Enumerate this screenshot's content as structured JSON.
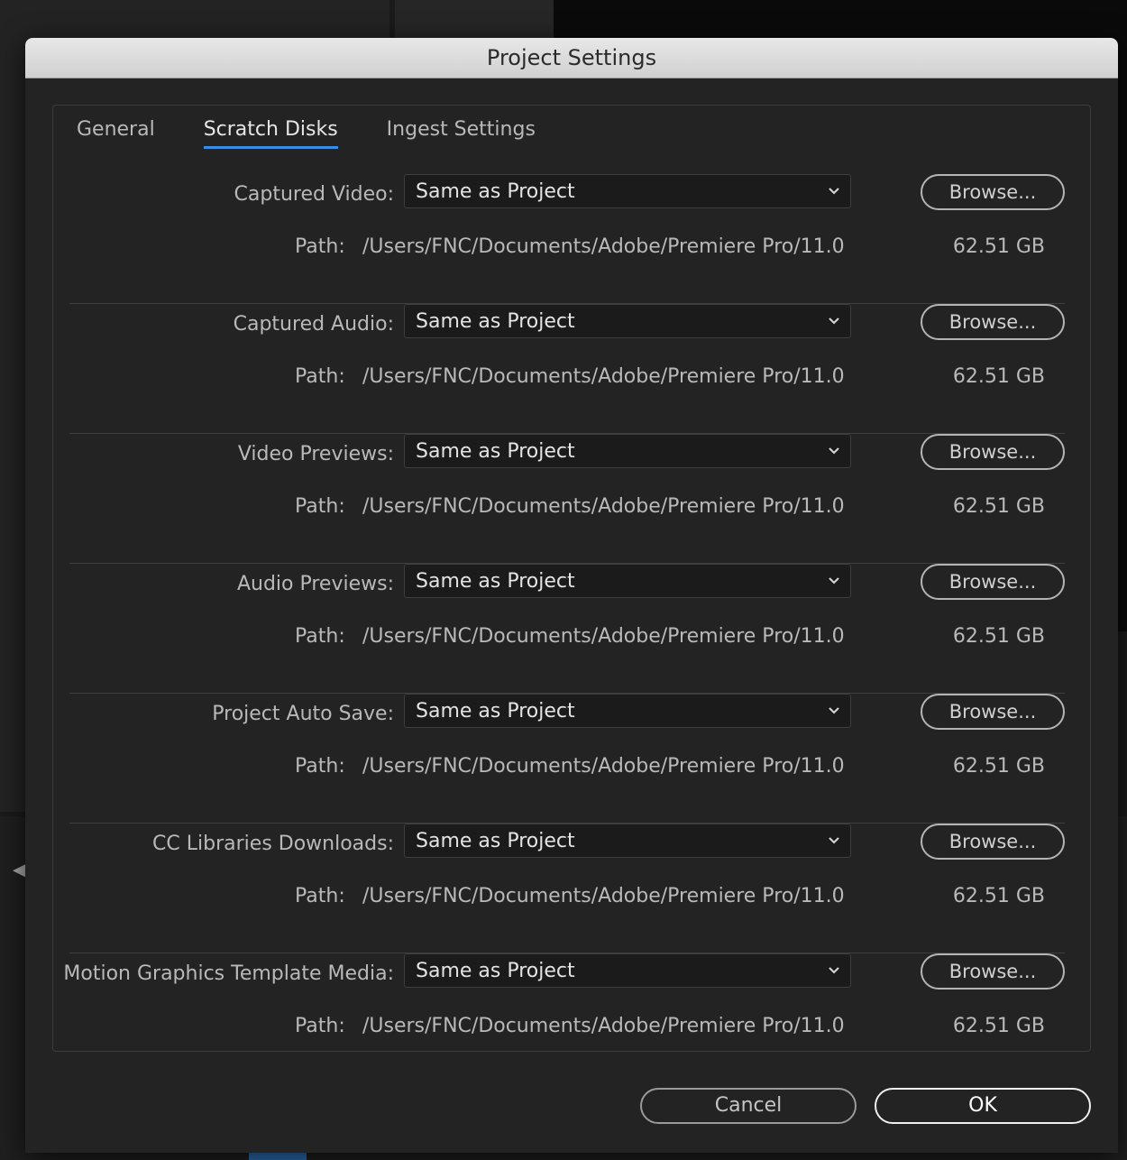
{
  "dialog": {
    "title": "Project Settings"
  },
  "tabs": [
    {
      "label": "General",
      "active": false
    },
    {
      "label": "Scratch Disks",
      "active": true
    },
    {
      "label": "Ingest Settings",
      "active": false
    }
  ],
  "path_label": "Path:",
  "rows": [
    {
      "label": "Captured Video:",
      "value": "Same as Project",
      "path": "/Users/FNC/Documents/Adobe/Premiere Pro/11.0",
      "size": "62.51 GB",
      "browse": "Browse..."
    },
    {
      "label": "Captured Audio:",
      "value": "Same as Project",
      "path": "/Users/FNC/Documents/Adobe/Premiere Pro/11.0",
      "size": "62.51 GB",
      "browse": "Browse..."
    },
    {
      "label": "Video Previews:",
      "value": "Same as Project",
      "path": "/Users/FNC/Documents/Adobe/Premiere Pro/11.0",
      "size": "62.51 GB",
      "browse": "Browse..."
    },
    {
      "label": "Audio Previews:",
      "value": "Same as Project",
      "path": "/Users/FNC/Documents/Adobe/Premiere Pro/11.0",
      "size": "62.51 GB",
      "browse": "Browse..."
    },
    {
      "label": "Project Auto Save:",
      "value": "Same as Project",
      "path": "/Users/FNC/Documents/Adobe/Premiere Pro/11.0",
      "size": "62.51 GB",
      "browse": "Browse..."
    },
    {
      "label": "CC Libraries Downloads:",
      "value": "Same as Project",
      "path": "/Users/FNC/Documents/Adobe/Premiere Pro/11.0",
      "size": "62.51 GB",
      "browse": "Browse..."
    },
    {
      "label": "Motion Graphics Template Media:",
      "value": "Same as Project",
      "path": "/Users/FNC/Documents/Adobe/Premiere Pro/11.0",
      "size": "62.51 GB",
      "browse": "Browse..."
    }
  ],
  "footer": {
    "cancel_label": "Cancel",
    "ok_label": "OK"
  },
  "colors": {
    "accent": "#3b8ce5",
    "dialog_bg": "#232323",
    "titlebar_bg": "#d8d8d8"
  },
  "icons": {
    "select_arrow": "chevron-down-icon",
    "background_nav": "chevron-left-icon"
  }
}
